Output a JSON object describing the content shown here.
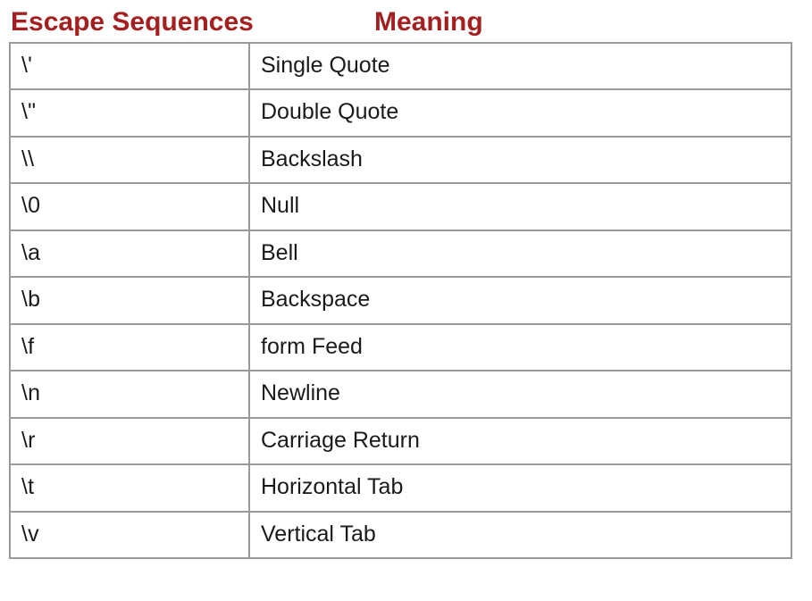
{
  "headers": {
    "sequences": "Escape Sequences",
    "meaning": "Meaning"
  },
  "rows": [
    {
      "seq": "\\'",
      "meaning": "Single Quote"
    },
    {
      "seq": "\\\"",
      "meaning": "Double Quote"
    },
    {
      "seq": "\\\\",
      "meaning": "Backslash"
    },
    {
      "seq": "\\0",
      "meaning": "Null"
    },
    {
      "seq": "\\a",
      "meaning": "Bell"
    },
    {
      "seq": "\\b",
      "meaning": "Backspace"
    },
    {
      "seq": "\\f",
      "meaning": "form Feed"
    },
    {
      "seq": "\\n",
      "meaning": "Newline"
    },
    {
      "seq": "\\r",
      "meaning": "Carriage Return"
    },
    {
      "seq": "\\t",
      "meaning": "Horizontal Tab"
    },
    {
      "seq": "\\v",
      "meaning": "Vertical Tab"
    }
  ]
}
